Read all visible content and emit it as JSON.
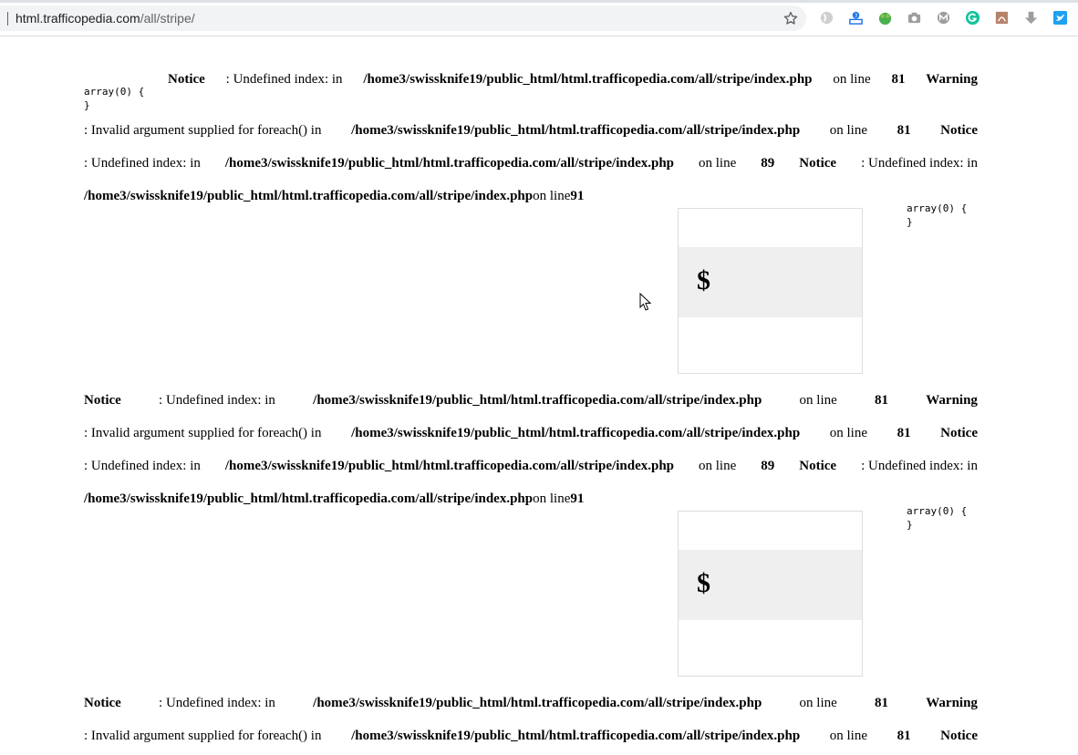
{
  "browser": {
    "url_host": "html.trafficopedia.com",
    "url_path": "/all/stripe/",
    "extensions": [
      "ghostery-icon",
      "translate-icon",
      "frog-icon",
      "camera-icon",
      "m-icon",
      "grammarly-icon",
      "pdf-icon",
      "download-icon",
      "twitter-icon"
    ]
  },
  "php": {
    "notice": "Notice",
    "warning": "Warning",
    "undefined_index": ": Undefined index: in",
    "invalid_argument": ": Invalid argument supplied for foreach() in",
    "path": "/home3/swissknife19/public_html/html.trafficopedia.com/all/stripe/index.php",
    "on_line": "on line",
    "line_81": "81",
    "line_89": "89",
    "line_91": "91",
    "array_dump_open": "array(0) {",
    "array_dump_close": "}"
  },
  "card": {
    "currency_symbol": "$"
  },
  "colors": {
    "card_band": "#efefef",
    "card_border": "#dddddd",
    "omnibox": "#f1f3f4"
  }
}
